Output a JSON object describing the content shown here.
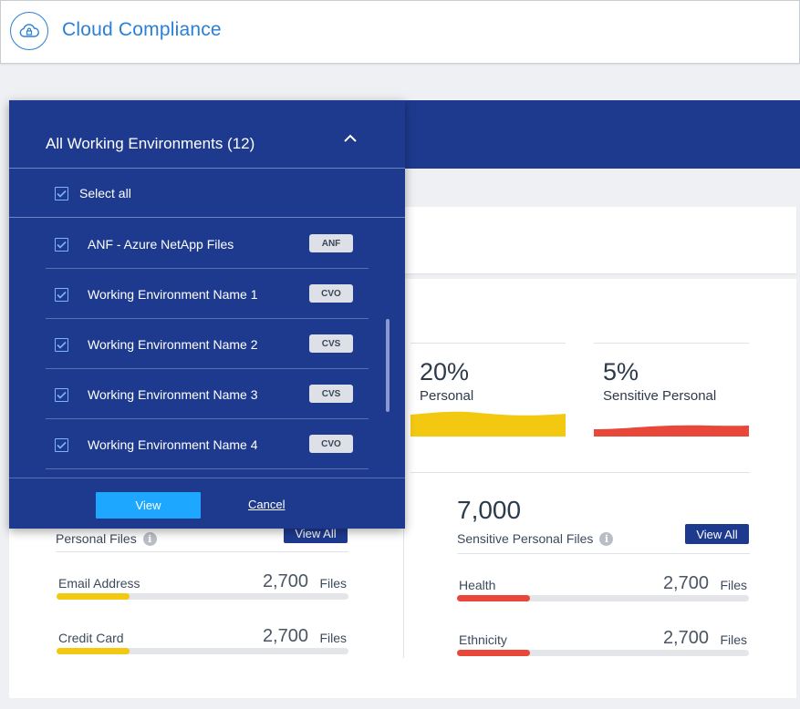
{
  "header": {
    "app_title": "Cloud Compliance",
    "logo_icon": "cloud-lock-icon"
  },
  "dropdown": {
    "title": "All Working Environments (12)",
    "select_all_label": "Select all",
    "items": [
      {
        "name": "ANF - Azure NetApp Files",
        "tag": "ANF",
        "checked": true
      },
      {
        "name": "Working Environment Name 1",
        "tag": "CVO",
        "checked": true
      },
      {
        "name": "Working Environment Name 2",
        "tag": "CVS",
        "checked": true
      },
      {
        "name": "Working Environment Name 3",
        "tag": "CVS",
        "checked": true
      },
      {
        "name": "Working Environment Name 4",
        "tag": "CVO",
        "checked": true
      }
    ],
    "view_label": "View",
    "cancel_label": "Cancel"
  },
  "stats": {
    "personal": {
      "percent": "20%",
      "label": "Personal",
      "color": "#f2c811"
    },
    "sensitive": {
      "percent": "5%",
      "label": "Sensitive Personal",
      "color": "#e8473a"
    }
  },
  "personal_files": {
    "label": "Personal Files",
    "view_all": "View All",
    "rows": [
      {
        "name": "Email Address",
        "count": "2,700",
        "unit": "Files",
        "fill": 0.25
      },
      {
        "name": "Credit Card",
        "count": "2,700",
        "unit": "Files",
        "fill": 0.25
      }
    ]
  },
  "sensitive_files": {
    "count": "7,000",
    "label": "Sensitive Personal Files",
    "view_all": "View All",
    "rows": [
      {
        "name": "Health",
        "count": "2,700",
        "unit": "Files",
        "fill": 0.25
      },
      {
        "name": "Ethnicity",
        "count": "2,700",
        "unit": "Files",
        "fill": 0.25
      }
    ]
  },
  "colors": {
    "navy": "#1e3a8f",
    "accent_blue": "#2a7fd8",
    "button_blue": "#1ea7ff",
    "yellow": "#f2c811",
    "red": "#e8473a"
  }
}
